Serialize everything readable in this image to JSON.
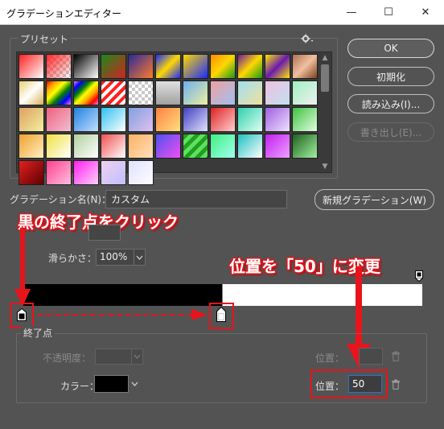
{
  "window": {
    "title": "グラデーションエディター",
    "minimize_glyph": "—",
    "maximize_glyph": "☐",
    "close_glyph": "✕"
  },
  "presets": {
    "legend": "プリセット",
    "gear_icon": "gear-icon"
  },
  "buttons": {
    "ok": "OK",
    "reset": "初期化",
    "load": "読み込み(I)...",
    "save": "書き出し(E)...",
    "new_gradient": "新規グラデーション(W)"
  },
  "name_row": {
    "label": "グラデーション名(N)：",
    "value": "カスタム"
  },
  "smoothness": {
    "label": "滑らかさ：",
    "value": "100%"
  },
  "end_point": {
    "legend": "終了点",
    "opacity_label": "不透明度：",
    "opacity_value": "",
    "position_label_top": "位置：",
    "position_value_top": "",
    "color_label": "カラー：",
    "color_value": "#000000",
    "position_label": "位置：",
    "position_value": "50"
  },
  "annotations": {
    "click_black_stop": "黒の終了点をクリック",
    "set_position": "位置を「50」に変更"
  },
  "colors": {
    "annotation_red": "#e8141c",
    "dialog_bg": "#535353"
  }
}
